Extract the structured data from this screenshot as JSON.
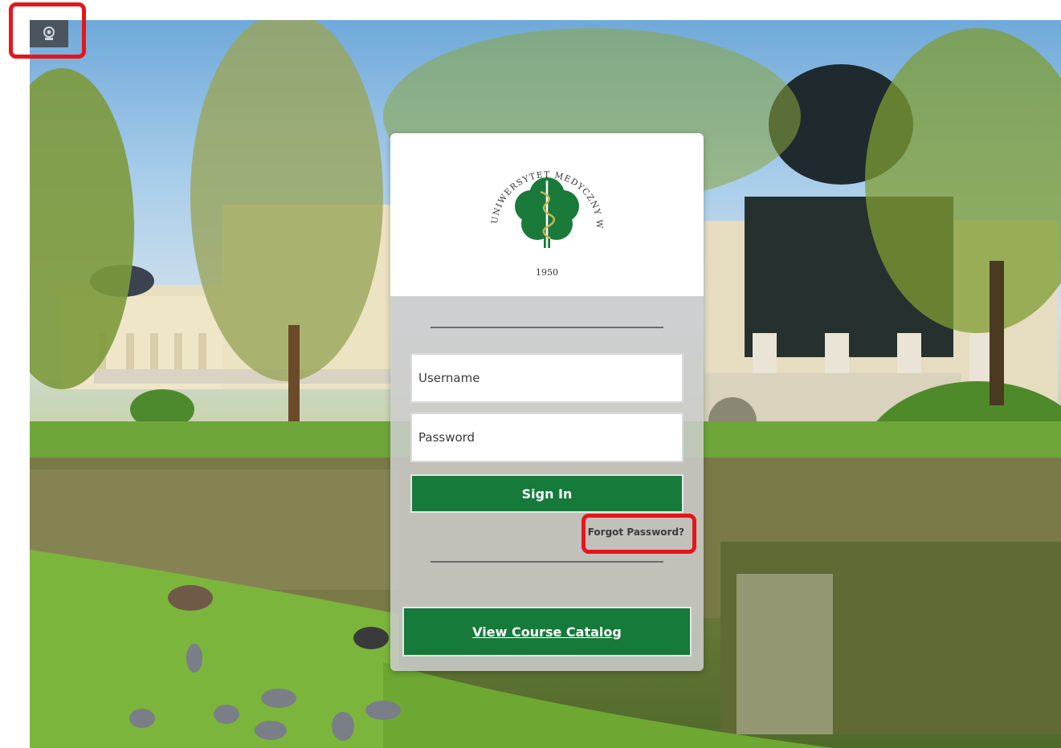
{
  "logo": {
    "arc_text": "UNIWERSYTET MEDYCZNY W BIAŁYMSTOKU",
    "year": "1950"
  },
  "login": {
    "username_placeholder": "Username",
    "password_placeholder": "Password",
    "sign_in_label": "Sign In",
    "forgot_password_label": "Forgot Password?",
    "catalog_label": "View Course Catalog"
  },
  "colors": {
    "brand_green": "#167a3a",
    "highlight_red": "#e8141c"
  },
  "icons": {
    "corner": "webcam-icon"
  }
}
